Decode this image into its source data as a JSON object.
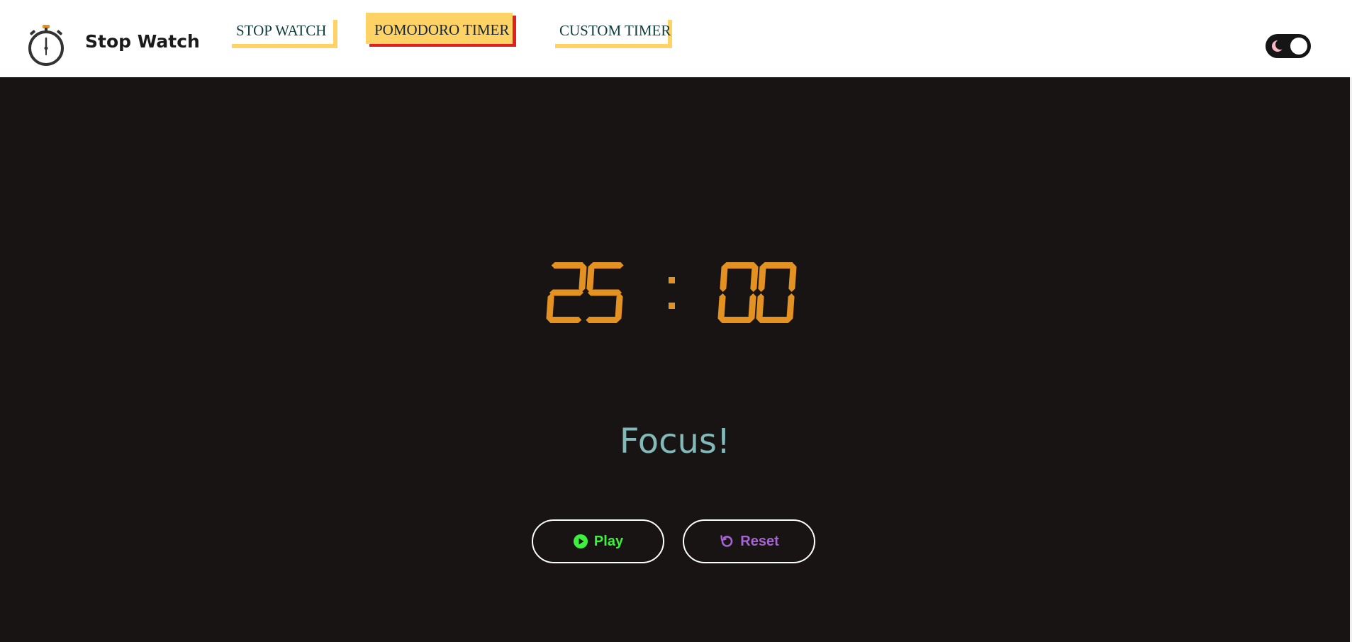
{
  "header": {
    "brand": "Stop Watch",
    "nav": [
      {
        "label": "STOP WATCH",
        "active": false
      },
      {
        "label": "POMODORO TIMER",
        "active": true
      },
      {
        "label": "CUSTOM TIMER",
        "active": false
      }
    ],
    "logo_icon": "stopwatch-icon",
    "theme_toggle": {
      "icon": "moon-icon",
      "state": "dark"
    }
  },
  "timer": {
    "minutes": "25",
    "separator": ":",
    "seconds": "00",
    "color": "#e39221"
  },
  "status": {
    "label": "Focus!",
    "color": "#84b9b9"
  },
  "controls": {
    "play": {
      "label": "Play",
      "icon": "play-circle-icon",
      "color": "#3cf03c"
    },
    "reset": {
      "label": "Reset",
      "icon": "rotate-left-icon",
      "color": "#a565d0"
    }
  },
  "colors": {
    "background": "#191414",
    "header_bg": "#ffffff",
    "nav_accent": "#ffd266",
    "nav_active_shadow": "#e21f1f"
  }
}
